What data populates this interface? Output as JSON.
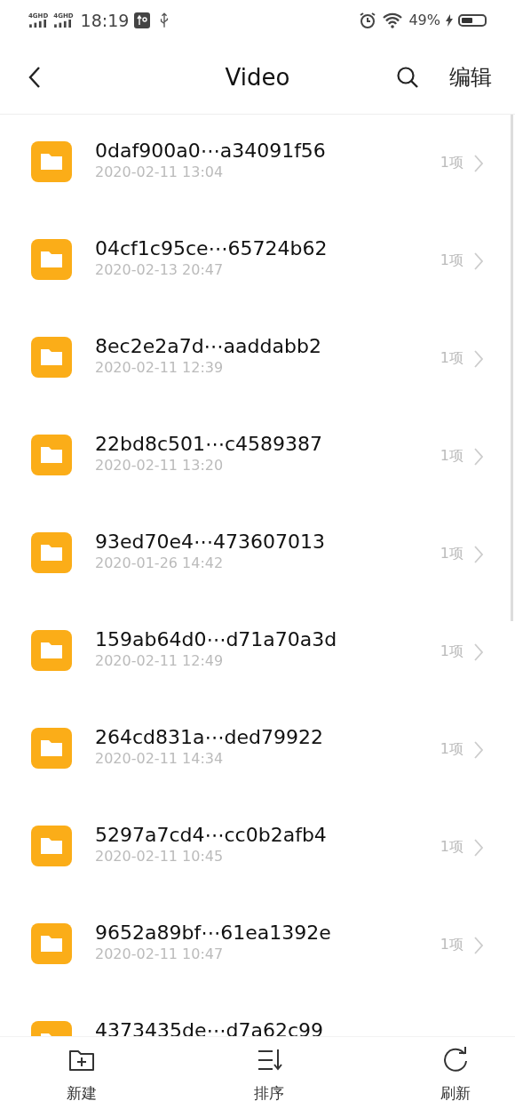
{
  "status_bar": {
    "networks": [
      "4GHD",
      "4GHD"
    ],
    "time": "18:19",
    "battery_percent": "49%"
  },
  "header": {
    "title": "Video",
    "edit": "编辑"
  },
  "folders": [
    {
      "name": "0daf900a0⋯a34091f56",
      "date": "2020-02-11 13:04",
      "count": "1项"
    },
    {
      "name": "04cf1c95ce⋯65724b62",
      "date": "2020-02-13 20:47",
      "count": "1项"
    },
    {
      "name": "8ec2e2a7d⋯aaddabb2",
      "date": "2020-02-11 12:39",
      "count": "1项"
    },
    {
      "name": "22bd8c501⋯c4589387",
      "date": "2020-02-11 13:20",
      "count": "1项"
    },
    {
      "name": "93ed70e4⋯473607013",
      "date": "2020-01-26 14:42",
      "count": "1项"
    },
    {
      "name": "159ab64d0⋯d71a70a3d",
      "date": "2020-02-11 12:49",
      "count": "1项"
    },
    {
      "name": "264cd831a⋯ded79922",
      "date": "2020-02-11 14:34",
      "count": "1项"
    },
    {
      "name": "5297a7cd4⋯cc0b2afb4",
      "date": "2020-02-11 10:45",
      "count": "1项"
    },
    {
      "name": "9652a89bf⋯61ea1392e",
      "date": "2020-02-11 10:47",
      "count": "1项"
    },
    {
      "name": "4373435de⋯d7a62c99"
    }
  ],
  "toolbar": [
    {
      "kind": "new",
      "label": "新建"
    },
    {
      "kind": "sort",
      "label": "排序"
    },
    {
      "kind": "refresh",
      "label": "刷新"
    }
  ]
}
